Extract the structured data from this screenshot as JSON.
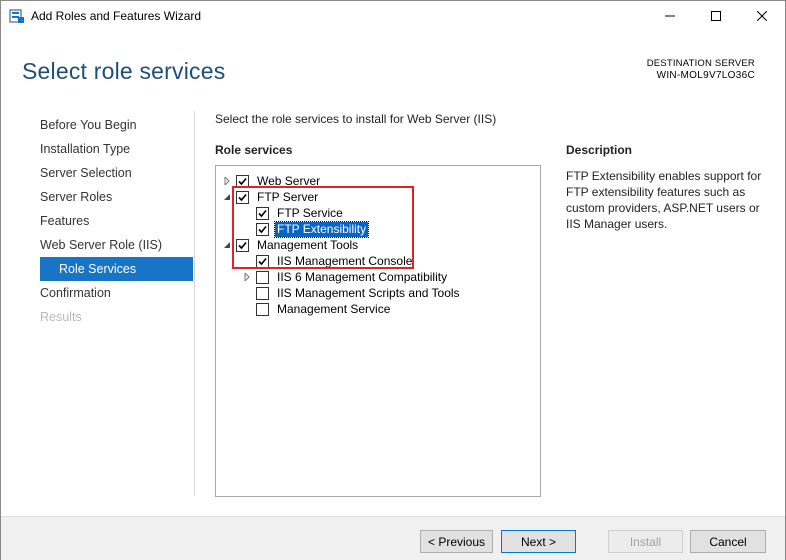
{
  "window": {
    "title": "Add Roles and Features Wizard",
    "minimize_icon": "minimize-icon",
    "maximize_icon": "maximize-icon",
    "close_icon": "close-icon"
  },
  "header": {
    "page_title": "Select role services",
    "destination_label": "DESTINATION SERVER",
    "destination_value": "WIN-MOL9V7LO36C"
  },
  "nav": {
    "items": [
      {
        "label": "Before You Begin",
        "state": "normal"
      },
      {
        "label": "Installation Type",
        "state": "normal"
      },
      {
        "label": "Server Selection",
        "state": "normal"
      },
      {
        "label": "Server Roles",
        "state": "normal"
      },
      {
        "label": "Features",
        "state": "normal"
      },
      {
        "label": "Web Server Role (IIS)",
        "state": "normal"
      },
      {
        "label": "Role Services",
        "state": "active"
      },
      {
        "label": "Confirmation",
        "state": "normal"
      },
      {
        "label": "Results",
        "state": "disabled"
      }
    ]
  },
  "main": {
    "instruction": "Select the role services to install for Web Server (IIS)",
    "role_services_heading": "Role services",
    "tree": [
      {
        "label": "Web Server",
        "checked": true,
        "expander": "collapsed"
      },
      {
        "label": "FTP Server",
        "checked": true,
        "expander": "expanded"
      },
      {
        "label": "FTP Service",
        "checked": true,
        "expander": "none"
      },
      {
        "label": "FTP Extensibility",
        "checked": true,
        "expander": "none",
        "selected": true
      },
      {
        "label": "Management Tools",
        "checked": true,
        "expander": "expanded"
      },
      {
        "label": "IIS Management Console",
        "checked": true,
        "expander": "none"
      },
      {
        "label": "IIS 6 Management Compatibility",
        "checked": false,
        "expander": "collapsed"
      },
      {
        "label": "IIS Management Scripts and Tools",
        "checked": false,
        "expander": "none"
      },
      {
        "label": "Management Service",
        "checked": false,
        "expander": "none"
      }
    ],
    "highlight_color": "#e0222a"
  },
  "description": {
    "heading": "Description",
    "text": "FTP Extensibility enables support for FTP extensibility features such as custom providers, ASP.NET users or IIS Manager users."
  },
  "footer": {
    "previous_label": "< Previous",
    "next_label": "Next >",
    "install_label": "Install",
    "cancel_label": "Cancel"
  },
  "colors": {
    "accent": "#1874c6",
    "title_blue": "#1e4e79",
    "selection": "#0a64c2"
  }
}
